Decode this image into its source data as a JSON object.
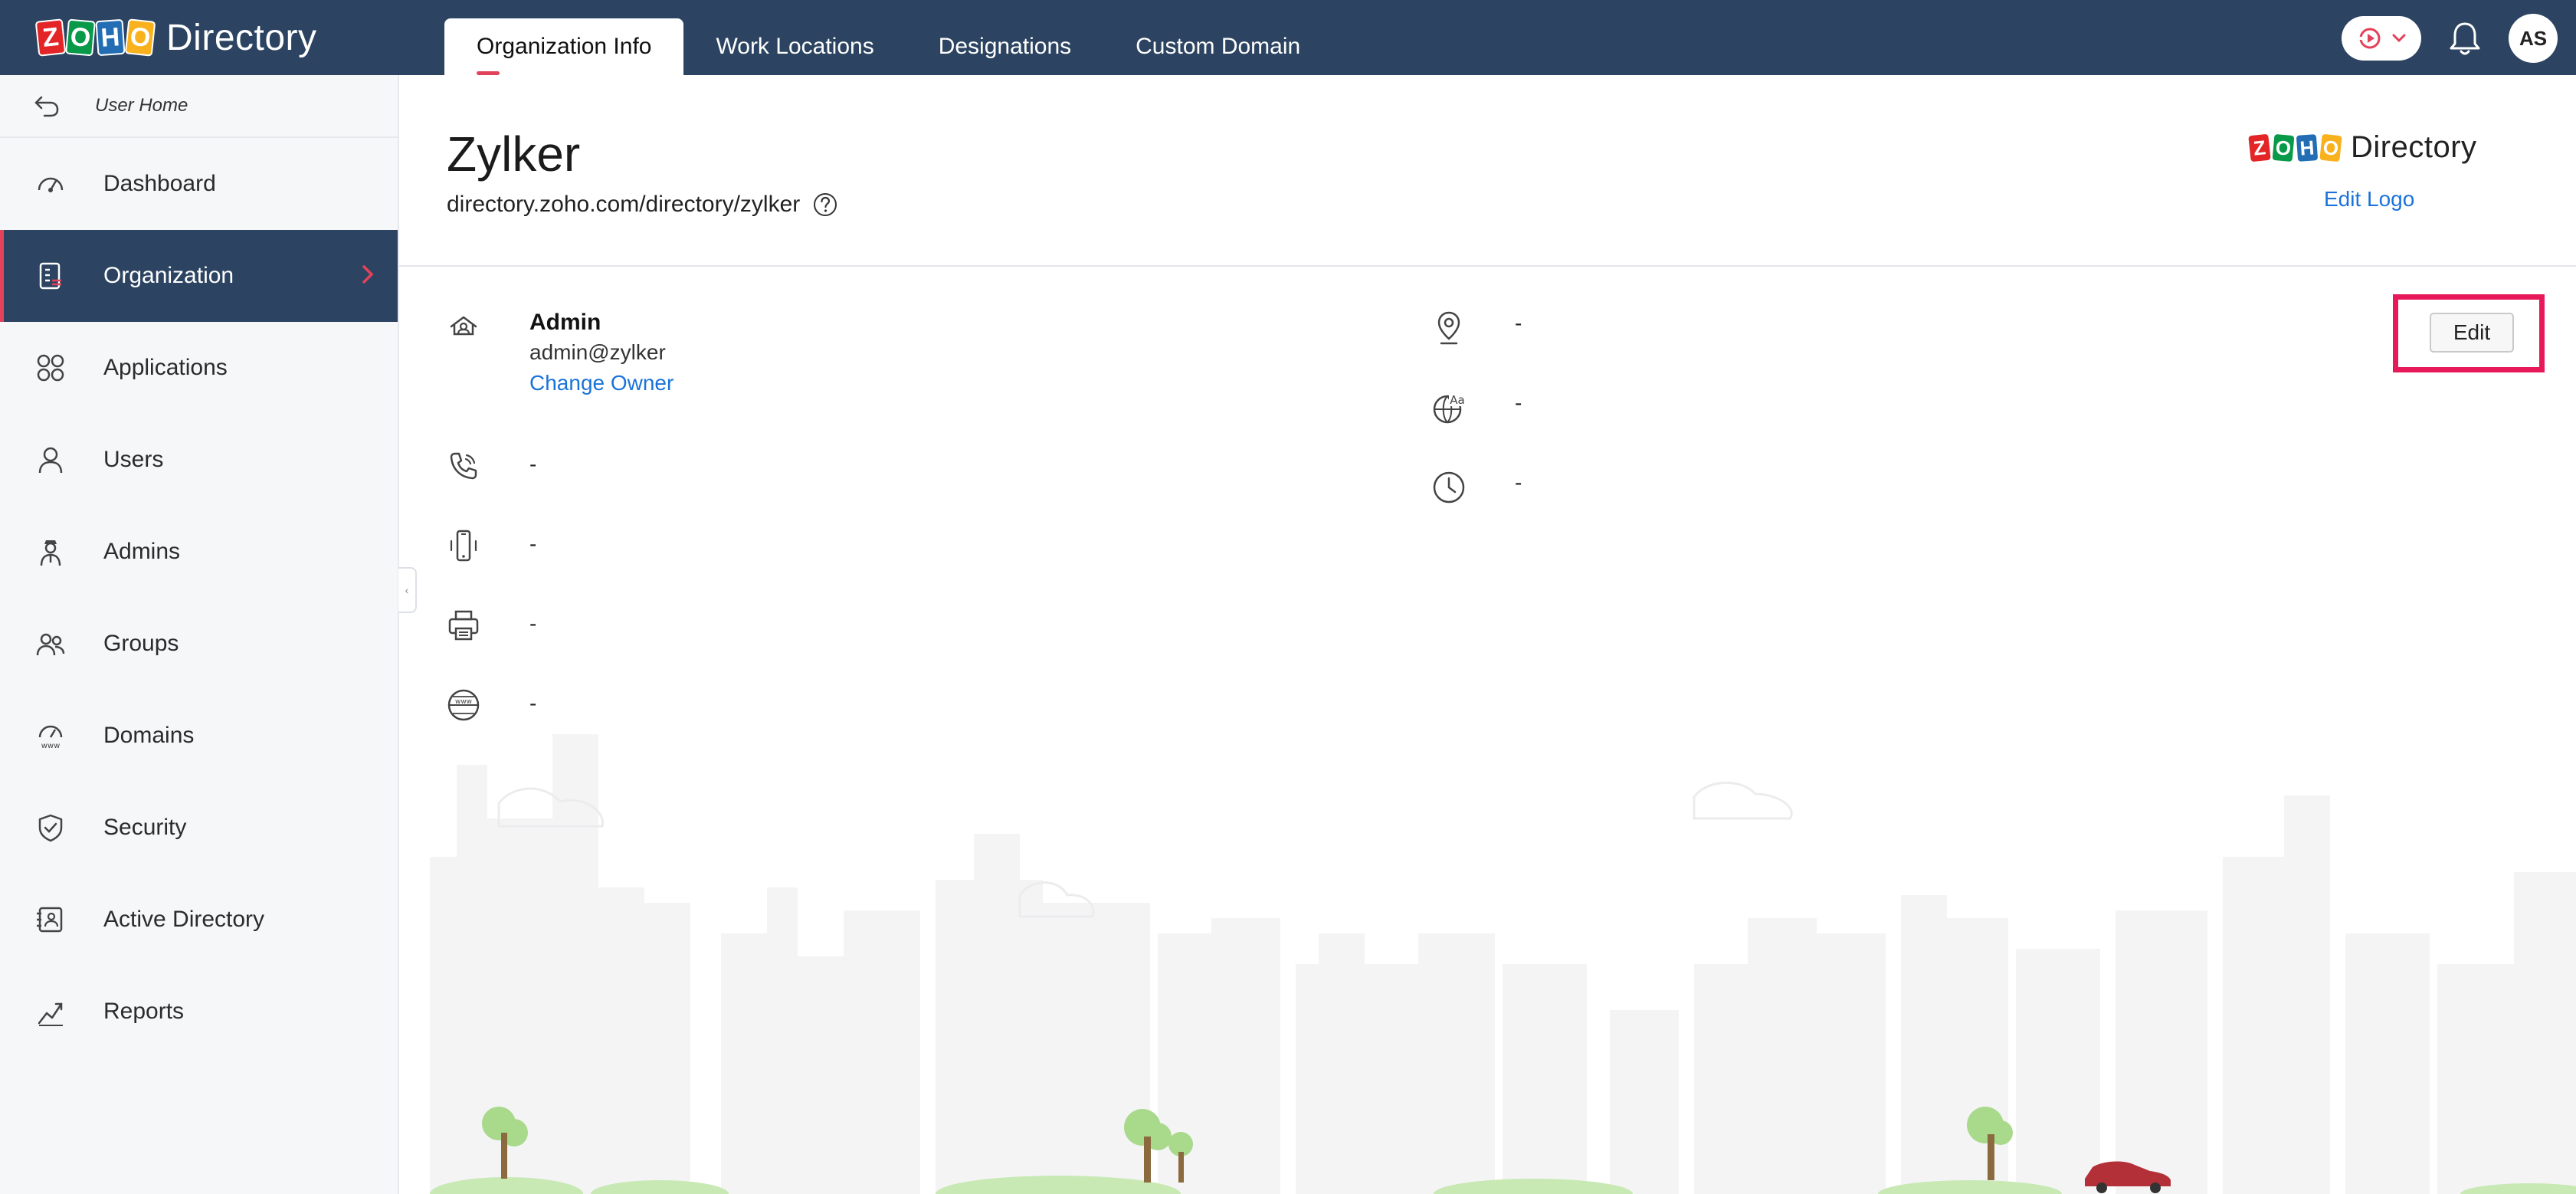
{
  "app": {
    "brand_letters": [
      "Z",
      "O",
      "H",
      "O"
    ],
    "brand_name": "Directory"
  },
  "header": {
    "tabs": [
      {
        "label": "Organization Info",
        "active": true
      },
      {
        "label": "Work Locations",
        "active": false
      },
      {
        "label": "Designations",
        "active": false
      },
      {
        "label": "Custom Domain",
        "active": false
      }
    ],
    "user_initials": "AS",
    "icons": [
      "meeting-icon",
      "chevron-down-icon",
      "bell-icon"
    ]
  },
  "sidebar": {
    "back_label": "User Home",
    "items": [
      {
        "label": "Dashboard",
        "icon": "dashboard-icon",
        "active": false
      },
      {
        "label": "Organization",
        "icon": "organization-icon",
        "active": true
      },
      {
        "label": "Applications",
        "icon": "applications-icon",
        "active": false
      },
      {
        "label": "Users",
        "icon": "user-icon",
        "active": false
      },
      {
        "label": "Admins",
        "icon": "admin-icon",
        "active": false
      },
      {
        "label": "Groups",
        "icon": "groups-icon",
        "active": false
      },
      {
        "label": "Domains",
        "icon": "domains-icon",
        "active": false
      },
      {
        "label": "Security",
        "icon": "security-icon",
        "active": false
      },
      {
        "label": "Active Directory",
        "icon": "active-directory-icon",
        "active": false
      },
      {
        "label": "Reports",
        "icon": "reports-icon",
        "active": false
      }
    ]
  },
  "org": {
    "name": "Zylker",
    "url": "directory.zoho.com/directory/zylker",
    "logo_name": "Directory",
    "edit_logo_label": "Edit Logo",
    "owner_title": "Admin",
    "owner_email": "admin@zylker",
    "change_owner_label": "Change Owner",
    "phone": "-",
    "mobile": "-",
    "fax": "-",
    "website": "-",
    "address": "-",
    "language": "-",
    "timezone": "-",
    "edit_label": "Edit"
  },
  "colors": {
    "header_bg": "#2c4461",
    "accent_pink": "#e2435b",
    "link_blue": "#1a73d9",
    "highlight": "#e8195a"
  }
}
